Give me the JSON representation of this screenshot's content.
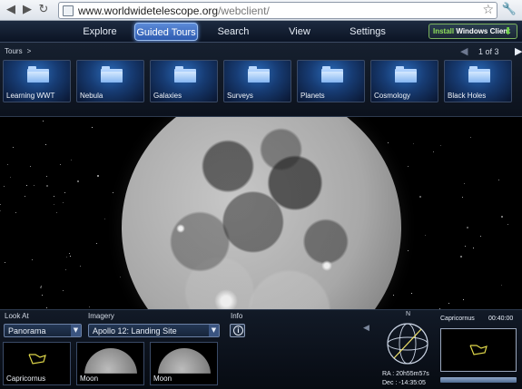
{
  "browser": {
    "url_host": "www.worldwidetelescope.org",
    "url_path": "/webclient/",
    "back_icon": "back-arrow-icon",
    "forward_icon": "forward-arrow-icon",
    "reload_icon": "reload-icon",
    "star_icon": "bookmark-star-icon",
    "wrench_icon": "wrench-icon"
  },
  "menu": {
    "items": [
      {
        "label": "Explore",
        "active": false
      },
      {
        "label": "Guided Tours",
        "active": true
      },
      {
        "label": "Search",
        "active": false
      },
      {
        "label": "View",
        "active": false
      },
      {
        "label": "Settings",
        "active": false
      }
    ],
    "install": {
      "prefix": "Install ",
      "emphasis": "Windows Client",
      "icon": "download-arrow-icon"
    }
  },
  "tours": {
    "breadcrumb": "Tours",
    "breadcrumb_sep": ">",
    "page_indicator": "1 of 3",
    "tiles": [
      {
        "label": "Learning WWT",
        "icon": "folder-icon"
      },
      {
        "label": "Nebula",
        "icon": "folder-icon"
      },
      {
        "label": "Galaxies",
        "icon": "folder-icon"
      },
      {
        "label": "Surveys",
        "icon": "folder-icon"
      },
      {
        "label": "Planets",
        "icon": "folder-icon"
      },
      {
        "label": "Cosmology",
        "icon": "folder-icon"
      },
      {
        "label": "Black Holes",
        "icon": "folder-icon"
      }
    ]
  },
  "view": {
    "object": "Moon"
  },
  "controls": {
    "look_at_label": "Look At",
    "look_at_value": "Panorama",
    "imagery_label": "Imagery",
    "imagery_value": "Apollo 12: Landing Site",
    "info_label": "Info",
    "thumbnails": [
      {
        "label": "Capricornus",
        "kind": "constellation"
      },
      {
        "label": "Moon",
        "kind": "moon"
      },
      {
        "label": "Moon",
        "kind": "moon"
      }
    ]
  },
  "navigator": {
    "north_label": "N",
    "ra": "RA : 20h55m57s",
    "dec": "Dec : -14:35:05",
    "minimap_title": "Capricornus",
    "minimap_time": "00:40:00"
  },
  "colors": {
    "accent": "#2e5bb0",
    "install_green": "#8fe05a",
    "panel_bg": "#121a27"
  }
}
